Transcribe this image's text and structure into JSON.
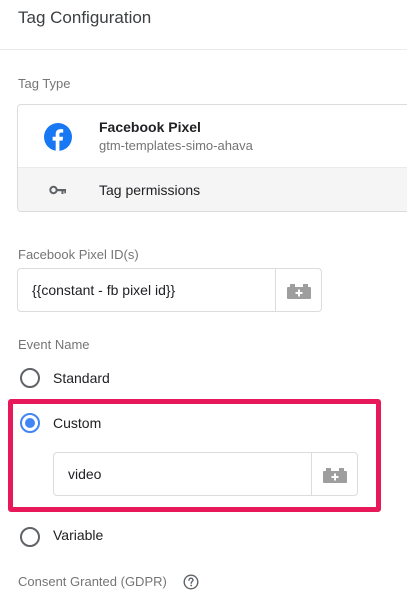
{
  "header": {
    "title": "Tag Configuration"
  },
  "tag_type": {
    "section_label": "Tag Type",
    "template_name": "Facebook Pixel",
    "template_source": "gtm-templates-simo-ahava",
    "permissions_label": "Tag permissions",
    "brand_color": "#1877f2"
  },
  "pixel_id": {
    "label": "Facebook Pixel ID(s)",
    "value": "{{constant - fb pixel id}}"
  },
  "event_name": {
    "label": "Event Name",
    "options": [
      {
        "label": "Standard",
        "selected": false
      },
      {
        "label": "Custom",
        "selected": true
      },
      {
        "label": "Variable",
        "selected": false
      }
    ],
    "custom_value": "video"
  },
  "consent": {
    "label": "Consent Granted (GDPR)"
  },
  "colors": {
    "accent": "#4285f4",
    "highlight_border": "#e8195b"
  }
}
